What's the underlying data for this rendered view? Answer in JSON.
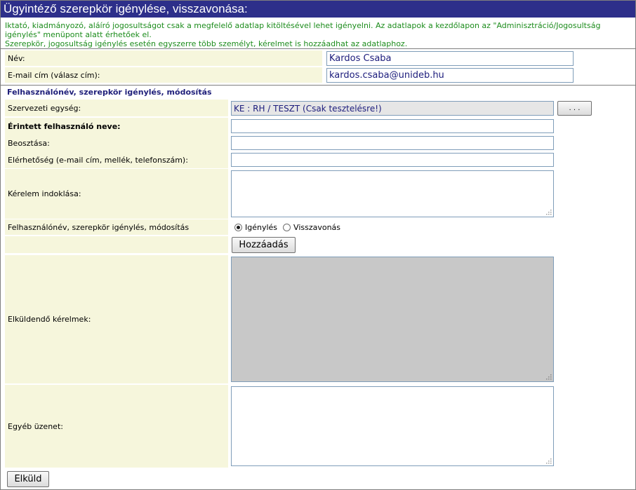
{
  "title": "Ügyintéző szerepkör igénylése, visszavonása:",
  "info": {
    "line1": "Iktató, kiadmányozó, aláíró jogosultságot csak a megfelelő adatlap kitöltésével lehet igényelni. Az adatlapok a kezdőlapon az \"Adminisztráció/Jogosultság igénylés\" menüpont alatt érhetőek el.",
    "line2": "Szerepkör, jogosultság igénylés esetén egyszerre több személyt, kérelmet is hozzáadhat az adatlaphoz."
  },
  "requester": {
    "name_label": "Név:",
    "name_value": "Kardos Csaba",
    "email_label": "E-mail cím (válasz cím):",
    "email_value": "kardos.csaba@unideb.hu"
  },
  "request": {
    "section_title": "Felhasználónév, szerepkör igénylés, módosítás",
    "unit_label": "Szervezeti egység:",
    "unit_value": "KE : RH / TESZT (Csak tesztelésre!)",
    "unit_button": ". . .",
    "affected_user_label": "Érintett felhasználó neve:",
    "affected_user_value": "",
    "position_label": "Beosztása:",
    "position_value": "",
    "contact_label": "Elérhetőség (e-mail cím, mellék, telefonszám):",
    "contact_value": "",
    "reason_label": "Kérelem indoklása:",
    "mode_label": "Felhasználónév, szerepkör igénylés, módosítás",
    "mode_options": [
      "Igénylés",
      "Visszavonás"
    ],
    "mode_selected": "Igénylés",
    "add_button": "Hozzáadás",
    "pending_label": "Elküldendő kérelmek:",
    "other_message_label": "Egyéb üzenet:"
  },
  "submit_button": "Elküld"
}
